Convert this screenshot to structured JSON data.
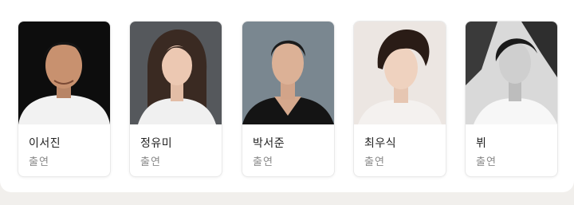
{
  "cast": [
    {
      "name": "이서진",
      "role": "출연",
      "photo": "portrait-photo"
    },
    {
      "name": "정유미",
      "role": "출연",
      "photo": "portrait-photo"
    },
    {
      "name": "박서준",
      "role": "출연",
      "photo": "portrait-photo"
    },
    {
      "name": "최우식",
      "role": "출연",
      "photo": "portrait-photo"
    },
    {
      "name": "뷔",
      "role": "출연",
      "photo": "portrait-photo"
    }
  ],
  "colors": {
    "background": "#f1efec",
    "panel": "#ffffff",
    "name_text": "#222222",
    "role_text": "#8a8a8a"
  }
}
